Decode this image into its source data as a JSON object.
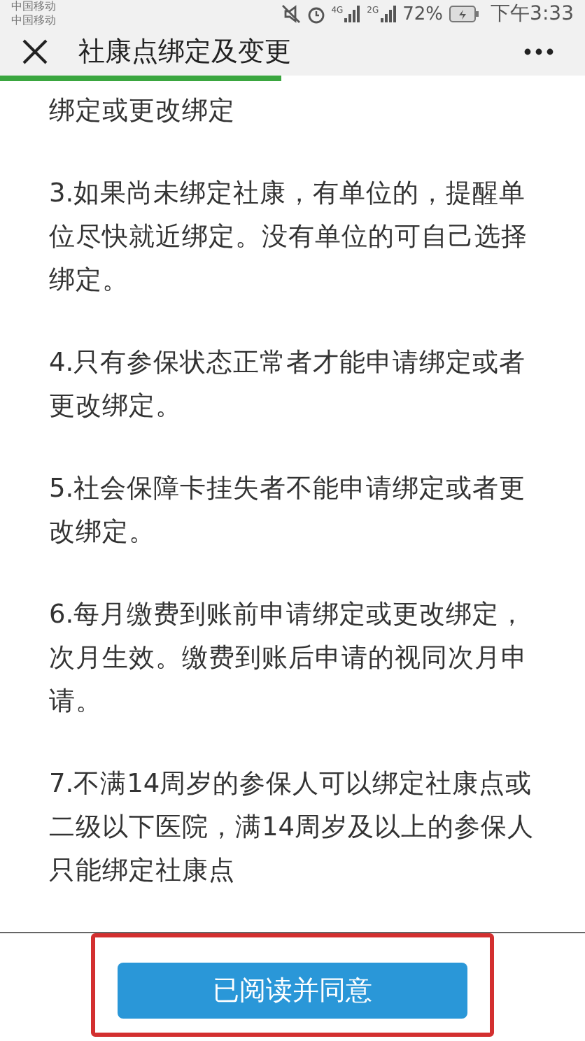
{
  "status_bar": {
    "carriers": [
      "中国移动",
      "中国移动"
    ],
    "signal_labels": [
      "4G",
      "2G"
    ],
    "battery": "72%",
    "time": "下午3:33"
  },
  "header": {
    "title": "社康点绑定及变更"
  },
  "progress": {
    "level": 0.48
  },
  "paragraphs": [
    "绑定或更改绑定",
    "3.如果尚未绑定社康，有单位的，提醒单位尽快就近绑定。没有单位的可自己选择绑定。",
    "4.只有参保状态正常者才能申请绑定或者更改绑定。",
    "5.社会保障卡挂失者不能申请绑定或者更改绑定。",
    "6.每月缴费到账前申请绑定或更改绑定，次月生效。缴费到账后申请的视同次月申请。",
    "7.不满14周岁的参保人可以绑定社康点或二级以下医院，满14周岁及以上的参保人只能绑定社康点"
  ],
  "agree_button": {
    "label": "已阅读并同意",
    "highlighted": true
  }
}
